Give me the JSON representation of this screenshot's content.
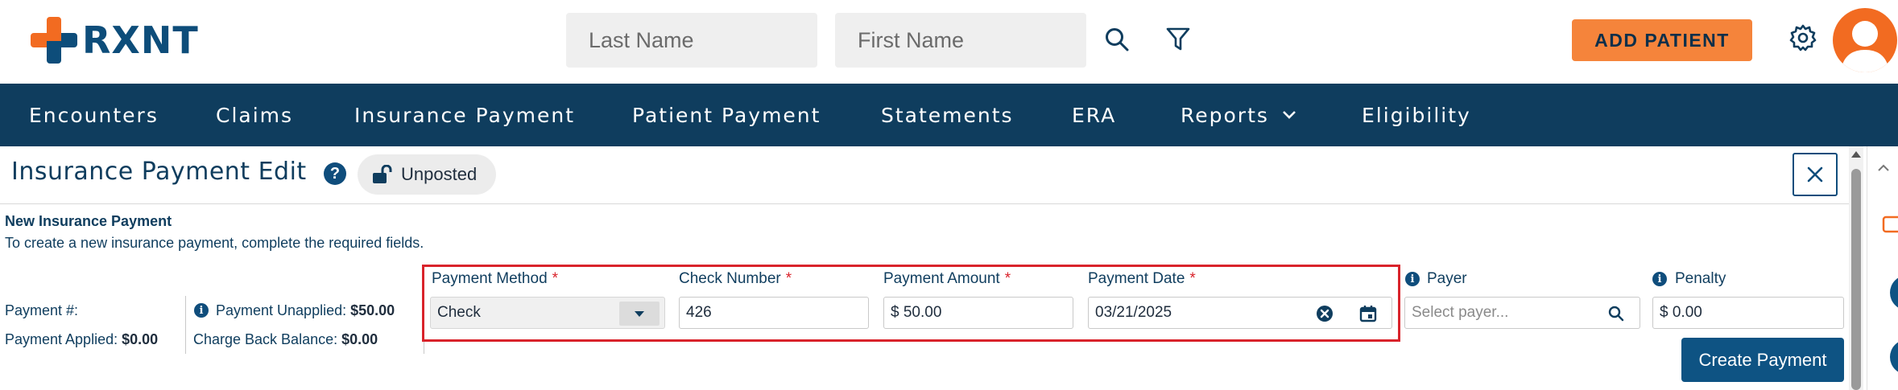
{
  "app": {
    "brand": "RXNT",
    "colors": {
      "accent": "#f5843b",
      "nav": "#0f3d5e",
      "primary": "#0e5383",
      "required": "#d9232b"
    }
  },
  "header": {
    "last_name_placeholder": "Last Name",
    "first_name_placeholder": "First Name",
    "search_icon": "search-icon",
    "filter_icon": "filter-icon",
    "add_patient_label": "ADD PATIENT",
    "settings_icon": "gear-icon"
  },
  "nav": {
    "items": [
      {
        "label": "Encounters"
      },
      {
        "label": "Claims"
      },
      {
        "label": "Insurance Payment"
      },
      {
        "label": "Patient Payment"
      },
      {
        "label": "Statements"
      },
      {
        "label": "ERA"
      },
      {
        "label": "Reports"
      },
      {
        "label": "Eligibility"
      }
    ]
  },
  "page": {
    "title": "Insurance Payment Edit",
    "help_glyph": "?",
    "status": "Unposted"
  },
  "form": {
    "section_title": "New Insurance Payment",
    "section_desc": "To create a new insurance payment, complete the required fields.",
    "summary": {
      "payment_number_label": "Payment #:",
      "payment_applied_label": "Payment Applied:",
      "payment_applied_value": "$0.00",
      "payment_unapplied_label": "Payment Unapplied:",
      "payment_unapplied_value": "$50.00",
      "charge_back_label": "Charge Back Balance:",
      "charge_back_value": "$0.00"
    },
    "fields": {
      "payment_method": {
        "label": "Payment Method",
        "value": "Check",
        "required": "*"
      },
      "check_number": {
        "label": "Check Number",
        "value": "426",
        "required": "*"
      },
      "payment_amount": {
        "label": "Payment Amount",
        "value": "$ 50.00",
        "required": "*"
      },
      "payment_date": {
        "label": "Payment Date",
        "value": "03/21/2025",
        "required": "*"
      },
      "payer": {
        "label": "Payer",
        "placeholder": "Select payer..."
      },
      "penalty": {
        "label": "Penalty",
        "value": "$ 0.00"
      }
    },
    "create_button": "Create Payment"
  }
}
